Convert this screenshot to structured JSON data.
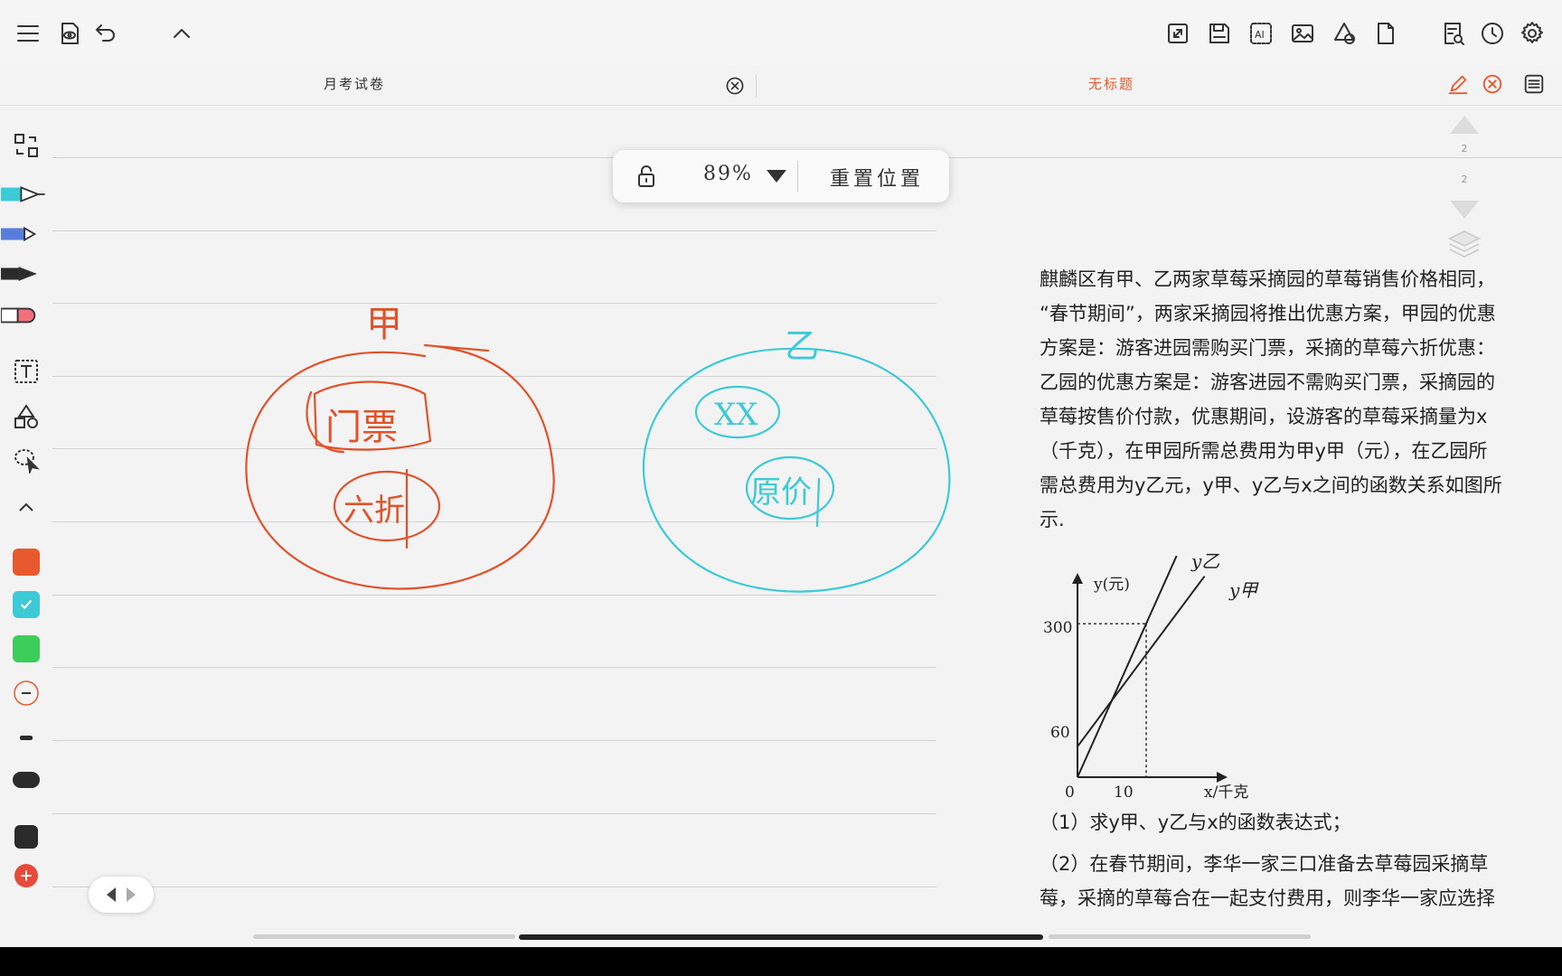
{
  "colors": {
    "accent_red": "#e85a2e",
    "ink_orange": "#e2522a",
    "ink_cyan": "#3ccad6",
    "swatch_green": "#3ccd5a",
    "swatch_dark": "#2b2b2b"
  },
  "tabs": [
    {
      "title": "月考试卷",
      "active": false
    },
    {
      "title": "无标题",
      "active": true
    }
  ],
  "zoom": {
    "value": "89%",
    "reset_label": "重置位置"
  },
  "right_nav": {
    "page_a": "2",
    "page_b": "2"
  },
  "problem": {
    "lines": [
      "麒麟区有甲、乙两家草莓采摘园的草莓销售价格相同，",
      "“春节期间”，两家采摘园将推出优惠方案，甲园的优惠",
      "方案是：游客进园需购买门票，采摘的草莓六折优惠：",
      "乙园的优惠方案是：游客进园不需购买门票，采摘园的",
      "草莓按售价付款，优惠期间，设游客的草莓采摘量为x",
      "（千克），在甲园所需总费用为甲y甲（元），在乙园所",
      "需总费用为y乙元，y甲、y乙与x之间的函数关系如图所",
      "示."
    ],
    "q1": "（1）求y甲、y乙与x的函数表达式；",
    "q2_line1": "（2）在春节期间，李华一家三口准备去草莓园采摘草",
    "q2_line2": "莓，采摘的草莓合在一起支付费用，则李华一家应选择"
  },
  "chart": {
    "ylabel": "y(元)",
    "xlabel": "x/千克",
    "series_a": "y乙",
    "series_b": "y甲",
    "tick_300": "300",
    "tick_60": "60",
    "tick_10": "10",
    "origin": "0"
  },
  "chart_data": {
    "type": "line",
    "x": [
      0,
      10
    ],
    "series": [
      {
        "name": "y乙",
        "values": [
          0,
          300
        ]
      },
      {
        "name": "y甲",
        "values": [
          60,
          240
        ]
      }
    ],
    "xlabel": "x/千克",
    "ylabel": "y(元)"
  },
  "handwriting": {
    "jia": "甲",
    "yi": "乙",
    "ticket": "门票",
    "sixty_pct": "六折",
    "xx": "XX",
    "original_price": "原价"
  }
}
